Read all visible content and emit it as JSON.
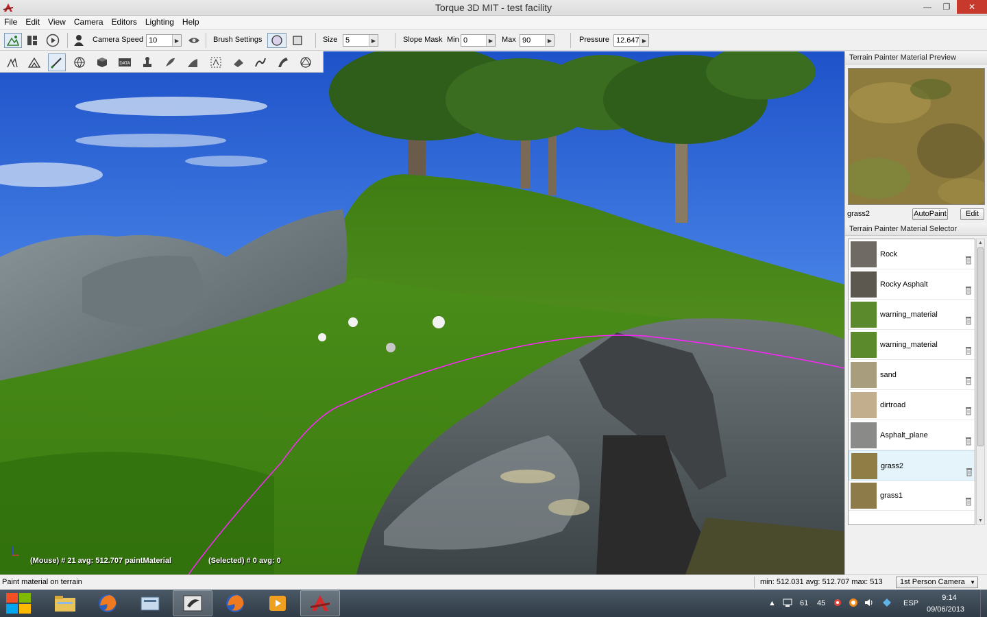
{
  "window": {
    "title": "Torque 3D MIT - test facility",
    "min_glyph": "—",
    "max_glyph": "❐",
    "close_glyph": "✕"
  },
  "menu": [
    "File",
    "Edit",
    "View",
    "Camera",
    "Editors",
    "Lighting",
    "Help"
  ],
  "toolbar": {
    "camera_speed_label": "Camera Speed",
    "camera_speed_value": "10",
    "brush_settings_label": "Brush Settings",
    "size_label": "Size",
    "size_value": "5",
    "slope_mask_label": "Slope Mask",
    "min_label": "Min",
    "min_value": "0",
    "max_label": "Max",
    "max_value": "90",
    "pressure_label": "Pressure",
    "pressure_value": "12.647"
  },
  "viewport": {
    "mouse_stats": "(Mouse) # 21  avg: 512.707 paintMaterial",
    "selected_stats": "(Selected) # 0  avg: 0"
  },
  "preview_panel": {
    "header": "Terrain Painter Material Preview",
    "material_name": "grass2",
    "autopaint_label": "AutoPaint",
    "edit_label": "Edit"
  },
  "selector_panel": {
    "header": "Terrain Painter Material Selector",
    "materials": [
      {
        "name": "Rock",
        "color": "#6f6a63"
      },
      {
        "name": "Rocky Asphalt",
        "color": "#5c574f"
      },
      {
        "name": "warning_material",
        "color": "#5b8a2c"
      },
      {
        "name": "warning_material",
        "color": "#5b8a2c"
      },
      {
        "name": "sand",
        "color": "#a89d7c"
      },
      {
        "name": "dirtroad",
        "color": "#c2ad8c"
      },
      {
        "name": "Asphalt_plane",
        "color": "#8a8a88"
      },
      {
        "name": "grass2",
        "color": "#8f7d45"
      },
      {
        "name": "grass1",
        "color": "#8e7b4a"
      }
    ],
    "selected_index": 7
  },
  "status": {
    "message": "Paint material on terrain",
    "stats": "min: 512.031  avg: 512.707  max: 513",
    "camera_mode": "1st Person Camera"
  },
  "taskbar": {
    "tray_fps": "61",
    "tray_num": "45",
    "lang": "ESP",
    "time": "9:14",
    "date": "09/06/2013"
  },
  "colors": {
    "accent": "#c7392c",
    "selection": "#e5f3fb",
    "brush_line": "#ff22ff"
  }
}
